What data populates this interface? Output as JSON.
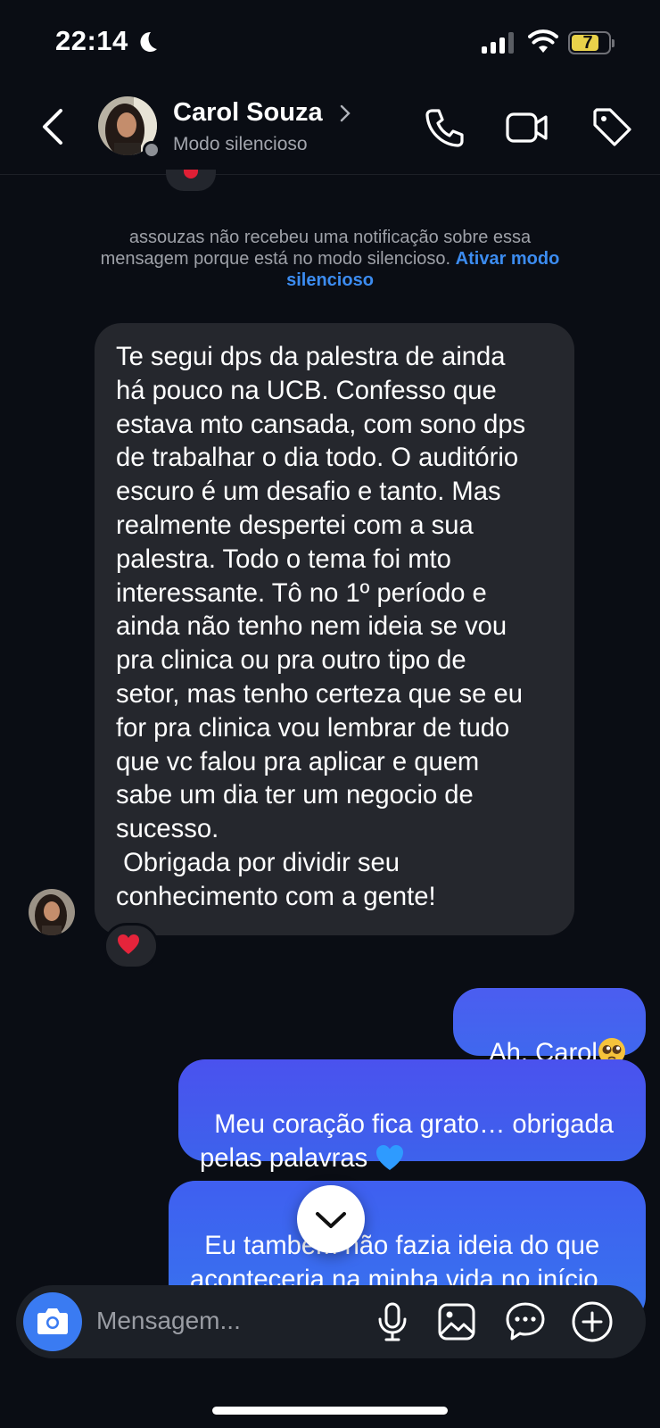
{
  "status_bar": {
    "time": "22:14",
    "battery_level": "7",
    "icons": [
      "moon-icon",
      "signal-icon",
      "wifi-icon",
      "battery-icon"
    ]
  },
  "header": {
    "contact_name": "Carol Souza",
    "contact_status": "Modo silencioso",
    "icons": [
      "back-icon",
      "chevron-right-icon",
      "phone-icon",
      "video-icon",
      "tag-icon"
    ]
  },
  "notice": {
    "text": "assouzas não recebeu uma notificação sobre essa mensagem porque está no modo silencioso. ",
    "link": "Ativar modo silencioso"
  },
  "messages": {
    "incoming": {
      "text": "Te segui dps da palestra de ainda\nhá pouco na UCB. Confesso que\nestava mto cansada, com sono dps\nde trabalhar o dia todo. O auditório\nescuro é um desafio e tanto. Mas\nrealmente despertei com a sua\npalestra. Todo o tema foi mto\ninteressante. Tô no 1º período e\nainda não tenho nem ideia se vou\npra clinica ou pra outro tipo de\nsetor, mas tenho certeza que se eu\nfor pra clinica vou lembrar de tudo\nque vc falou pra aplicar e quem\nsabe um dia ter um negocio de\nsucesso.\n Obrigada por dividir seu\nconhecimento com a gente!",
      "reaction": "heart-reaction"
    },
    "outgoing": [
      {
        "text": "Ah, Carol",
        "emoji": "pleading-face-emoji"
      },
      {
        "text": "Meu coração fica grato… obrigada\npelas palavras ",
        "emoji": "blue-heart-emoji"
      },
      {
        "text": "Eu também não fazia ideia do que\naconteceria na minha vida no início\nda graduação"
      }
    ]
  },
  "composer": {
    "placeholder": "Mensagem...",
    "icons": [
      "camera-icon",
      "microphone-icon",
      "gallery-icon",
      "sticker-icon",
      "plus-icon"
    ]
  },
  "colors": {
    "background": "#0a0d14",
    "incoming_bubble": "#25272d",
    "outgoing_bubble": "#4a5bef",
    "link": "#3c8cf0",
    "camera_button": "#3a7bf2"
  }
}
